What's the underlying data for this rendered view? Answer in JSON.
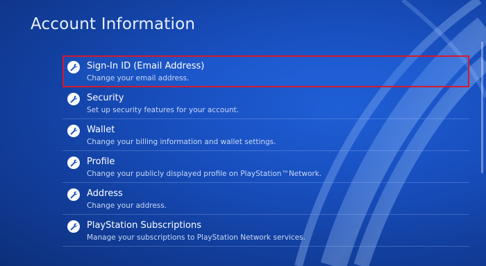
{
  "page": {
    "title": "Account Information"
  },
  "menu": {
    "items": [
      {
        "label": "Sign-In ID (Email Address)",
        "description": "Change your email address.",
        "icon": "wrench-icon",
        "selected": true
      },
      {
        "label": "Security",
        "description": "Set up security features for your account.",
        "icon": "wrench-icon",
        "selected": false
      },
      {
        "label": "Wallet",
        "description": "Change your billing information and wallet settings.",
        "icon": "wrench-icon",
        "selected": false
      },
      {
        "label": "Profile",
        "description": "Change your publicly displayed profile on PlayStation™Network.",
        "icon": "wrench-icon",
        "selected": false
      },
      {
        "label": "Address",
        "description": "Change your address.",
        "icon": "wrench-icon",
        "selected": false
      },
      {
        "label": "PlayStation Subscriptions",
        "description": "Manage your subscriptions to PlayStation Network services.",
        "icon": "wrench-icon",
        "selected": false
      }
    ]
  },
  "colors": {
    "background": "#184fbf",
    "highlight": "#d8182a",
    "text": "#ffffff",
    "subtext": "#c9d8f5"
  }
}
